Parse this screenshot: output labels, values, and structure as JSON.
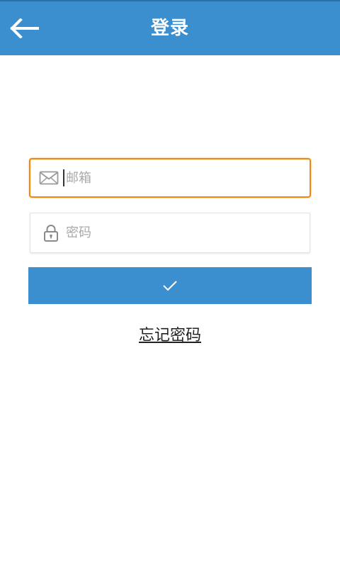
{
  "header": {
    "title": "登录",
    "back_icon": "arrow-left-icon",
    "background": "#3b8fcf"
  },
  "form": {
    "email": {
      "placeholder": "邮箱",
      "value": "",
      "icon": "envelope-icon",
      "focused": true,
      "focus_color": "#f0860d"
    },
    "password": {
      "placeholder": "密码",
      "value": "",
      "icon": "lock-icon"
    },
    "submit": {
      "icon": "checkmark-icon",
      "background": "#3b8fcf"
    },
    "forgot_password": "忘记密码"
  }
}
